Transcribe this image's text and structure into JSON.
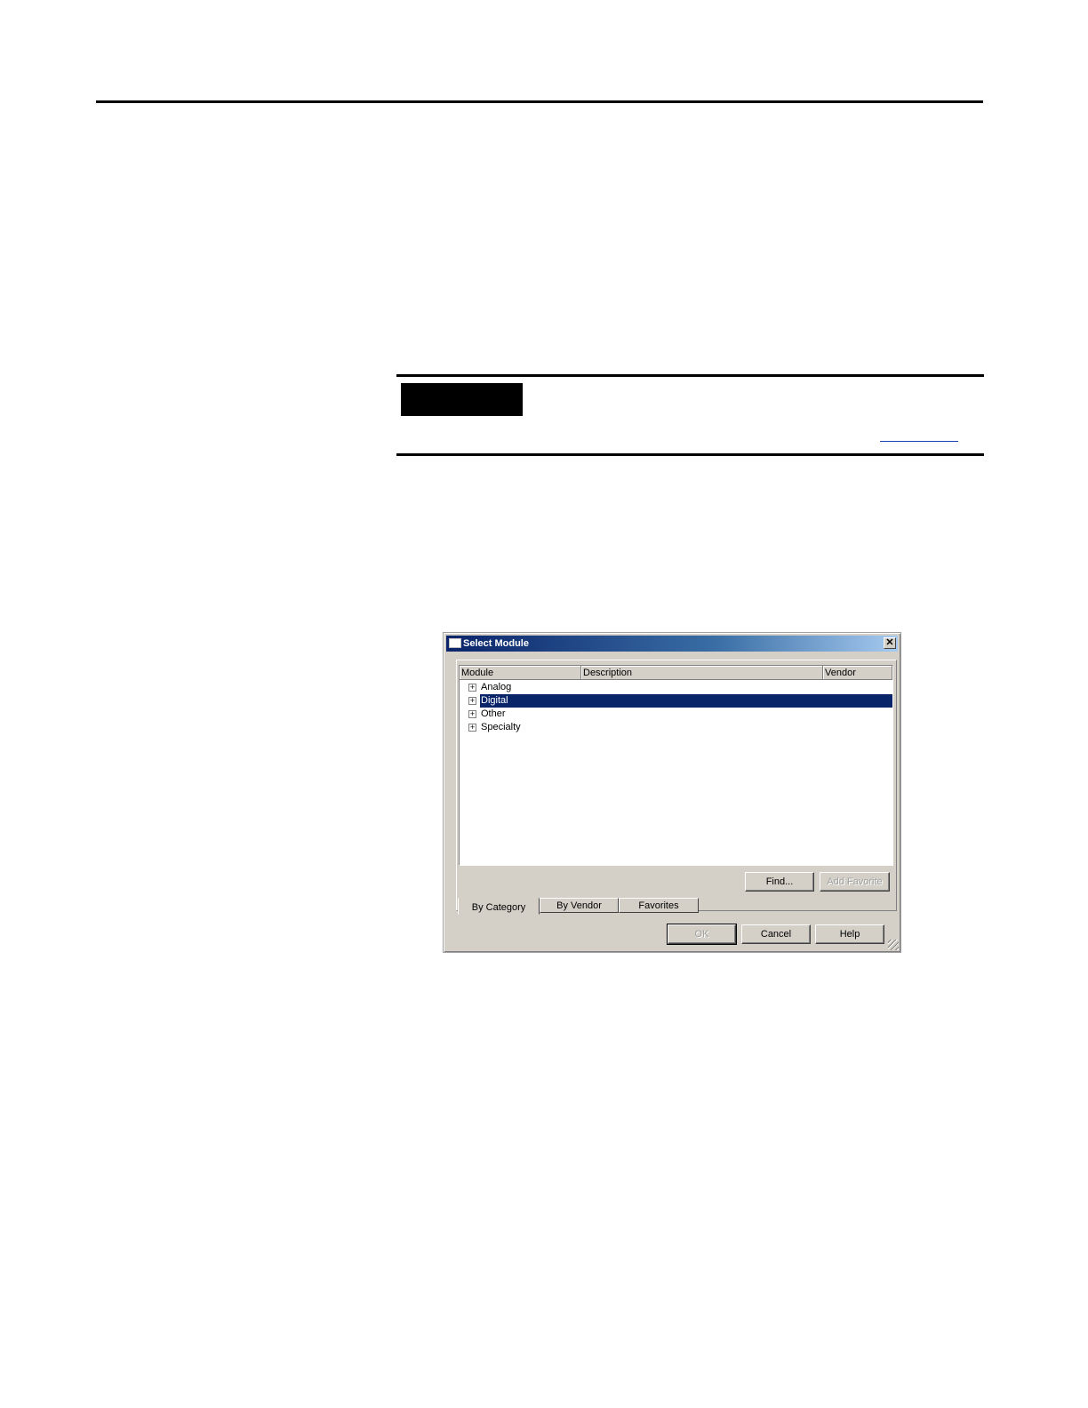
{
  "dialog": {
    "title": "Select Module",
    "close_glyph": "✕",
    "columns": [
      "Module",
      "Description",
      "Vendor"
    ],
    "tree_items": [
      {
        "label": "Analog",
        "expander": "+",
        "selected": false
      },
      {
        "label": "Digital",
        "expander": "+",
        "selected": true
      },
      {
        "label": "Other",
        "expander": "+",
        "selected": false
      },
      {
        "label": "Specialty",
        "expander": "+",
        "selected": false
      }
    ],
    "find_label": "Find...",
    "add_favorite_label": "Add Favorite",
    "tabs": [
      "By Category",
      "By Vendor",
      "Favorites"
    ],
    "active_tab": "By Category",
    "ok_label": "OK",
    "cancel_label": "Cancel",
    "help_label": "Help"
  },
  "colors": {
    "title_gradient_start": "#0a246a",
    "title_gradient_end": "#a6caf0",
    "selection": "#0a246a",
    "dialog_face": "#d4d0c8"
  }
}
